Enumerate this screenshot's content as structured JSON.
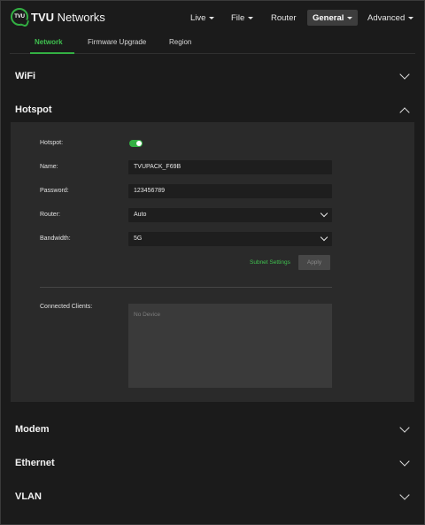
{
  "brand": {
    "logo_mark": "TVU",
    "name_bold": "TVU",
    "name_rest": " Networks"
  },
  "nav": {
    "live": "Live",
    "file": "File",
    "router": "Router",
    "general": "General",
    "advanced": "Advanced"
  },
  "subtabs": {
    "network": "Network",
    "firmware": "Firmware Upgrade",
    "region": "Region"
  },
  "sections": {
    "wifi": "WiFi",
    "hotspot": "Hotspot",
    "modem": "Modem",
    "ethernet": "Ethernet",
    "vlan": "VLAN"
  },
  "hotspot": {
    "toggle_label": "Hotspot:",
    "enabled": true,
    "name_label": "Name:",
    "name_value": "TVUPACK_F69B",
    "password_label": "Password:",
    "password_value": "123456789",
    "router_label": "Router:",
    "router_value": "Auto",
    "bandwidth_label": "Bandwidth:",
    "bandwidth_value": "5G",
    "subnet_settings": "Subnet Settings",
    "apply": "Apply",
    "clients_label": "Connected Clients:",
    "clients_empty": "No Device"
  },
  "colors": {
    "accent": "#33b043",
    "background": "#1b1b1b",
    "panel": "#2a2a2a"
  },
  "icons": [
    "chevron-down-icon",
    "chevron-up-icon",
    "caret-down-icon",
    "tvu-logo-icon"
  ]
}
